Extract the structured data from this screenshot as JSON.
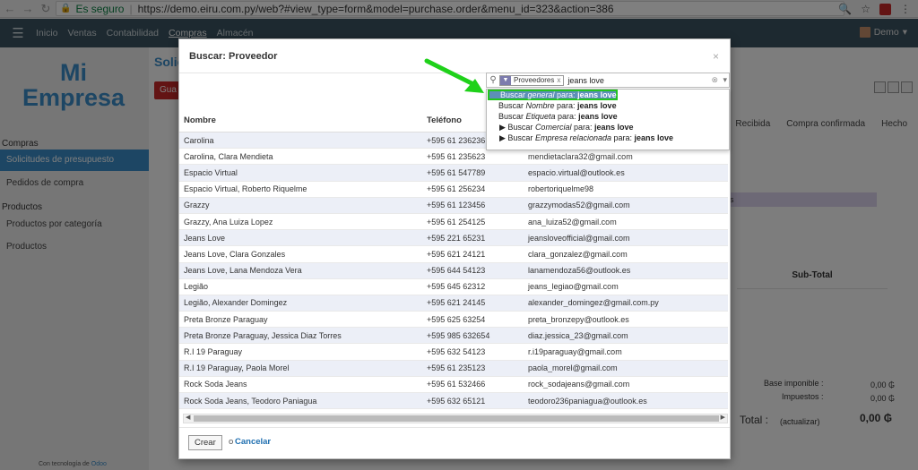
{
  "browser": {
    "secure_label": "Es seguro",
    "url": "https://demo.eiru.com.py/web?#view_type=form&model=purchase.order&menu_id=323&action=386"
  },
  "topbar": {
    "menu": [
      "Inicio",
      "Ventas",
      "Contabilidad",
      "Compras",
      "Almacén"
    ],
    "active": "Compras",
    "user": "Demo"
  },
  "sidebar": {
    "logo_line1": "Mi",
    "logo_line2": "Empresa",
    "section_compras": "Compras",
    "items_compras": [
      "Solicitudes de presupuesto",
      "Pedidos de compra"
    ],
    "section_productos": "Productos",
    "items_productos": [
      "Productos por categoría",
      "Productos"
    ],
    "powered_prefix": "Con tecnología de",
    "powered_brand": "Odoo"
  },
  "background_page": {
    "title": "Solic",
    "button": "Gua",
    "steps": [
      "Recibida",
      "Compra confirmada",
      "Hecho"
    ],
    "purple_text": "s",
    "subtotal_header": "Sub-Total",
    "base_label": "Base imponible :",
    "base_value": "0,00 ₲",
    "tax_label": "Impuestos :",
    "tax_value": "0,00 ₲",
    "total_label": "Total :",
    "total_update": "(actualizar)",
    "total_value": "0,00 ₲"
  },
  "modal": {
    "title": "Buscar: Proveedor",
    "close": "×",
    "search": {
      "facet_label": "Proveedores",
      "facet_remove": "x",
      "query": "jeans love"
    },
    "dropdown": [
      {
        "prefix": "Buscar ",
        "field": "general",
        "mid": " para: ",
        "term": "jeans love",
        "expand": false,
        "highlight": true
      },
      {
        "prefix": "Buscar ",
        "field": "Nombre",
        "mid": " para: ",
        "term": "jeans love",
        "expand": false,
        "highlight": false
      },
      {
        "prefix": "Buscar ",
        "field": "Etiqueta",
        "mid": " para: ",
        "term": "jeans love",
        "expand": false,
        "highlight": false
      },
      {
        "prefix": "Buscar ",
        "field": "Comercial",
        "mid": " para: ",
        "term": "jeans love",
        "expand": true,
        "highlight": false
      },
      {
        "prefix": "Buscar ",
        "field": "Empresa relacionada",
        "mid": " para: ",
        "term": "jeans love",
        "expand": true,
        "highlight": false
      }
    ],
    "columns": {
      "name": "Nombre",
      "phone": "Teléfono",
      "email": ""
    },
    "rows": [
      {
        "name": "Carolina",
        "phone": "+595 61 236236",
        "email": ""
      },
      {
        "name": "Carolina, Clara Mendieta",
        "phone": "+595 61 235623",
        "email": "mendietaclara32@gmail.com"
      },
      {
        "name": "Espacio Virtual",
        "phone": "+595 61 547789",
        "email": "espacio.virtual@outlook.es"
      },
      {
        "name": "Espacio Virtual, Roberto Riquelme",
        "phone": "+595 61 256234",
        "email": "robertoriquelme98"
      },
      {
        "name": "Grazzy",
        "phone": "+595 61 123456",
        "email": "grazzymodas52@gmail.com"
      },
      {
        "name": "Grazzy, Ana Luiza Lopez",
        "phone": "+595 61 254125",
        "email": "ana_luiza52@gmail.com"
      },
      {
        "name": "Jeans Love",
        "phone": "+595 221 65231",
        "email": "jeansloveofficial@gmail.com"
      },
      {
        "name": "Jeans Love, Clara Gonzales",
        "phone": "+595 621 24121",
        "email": "clara_gonzalez@gmail.com"
      },
      {
        "name": "Jeans Love, Lana Mendoza Vera",
        "phone": "+595 644 54123",
        "email": "lanamendoza56@outlook.es"
      },
      {
        "name": "Legião",
        "phone": "+595 645 62312",
        "email": "jeans_legiao@gmail.com"
      },
      {
        "name": "Legião, Alexander Domingez",
        "phone": "+595 621 24145",
        "email": "alexander_domingez@gmail.com.py"
      },
      {
        "name": "Preta Bronze Paraguay",
        "phone": "+595 625 63254",
        "email": "preta_bronzepy@outlook.es"
      },
      {
        "name": "Preta Bronze Paraguay, Jessica Diaz Torres",
        "phone": "+595 985 632654",
        "email": "diaz.jessica_23@gmail.com"
      },
      {
        "name": "R.I 19 Paraguay",
        "phone": "+595 632 54123",
        "email": "r.i19paraguay@gmail.com"
      },
      {
        "name": "R.I 19 Paraguay, Paola Morel",
        "phone": "+595 61 235123",
        "email": "paola_morel@gmail.com"
      },
      {
        "name": "Rock Soda Jeans",
        "phone": "+595 61 532466",
        "email": "rock_sodajeans@gmail.com"
      },
      {
        "name": "Rock Soda Jeans, Teodoro Paniagua",
        "phone": "+595 632 65121",
        "email": "teodoro236paniagua@outlook.es"
      }
    ],
    "footer": {
      "create": "Crear",
      "or": "o",
      "cancel": "Cancelar"
    }
  },
  "colors": {
    "topbar": "#3b5261",
    "accent": "#3a8cc8",
    "highlight_border": "#23c21f",
    "annotation_arrow": "#1fd11a"
  }
}
